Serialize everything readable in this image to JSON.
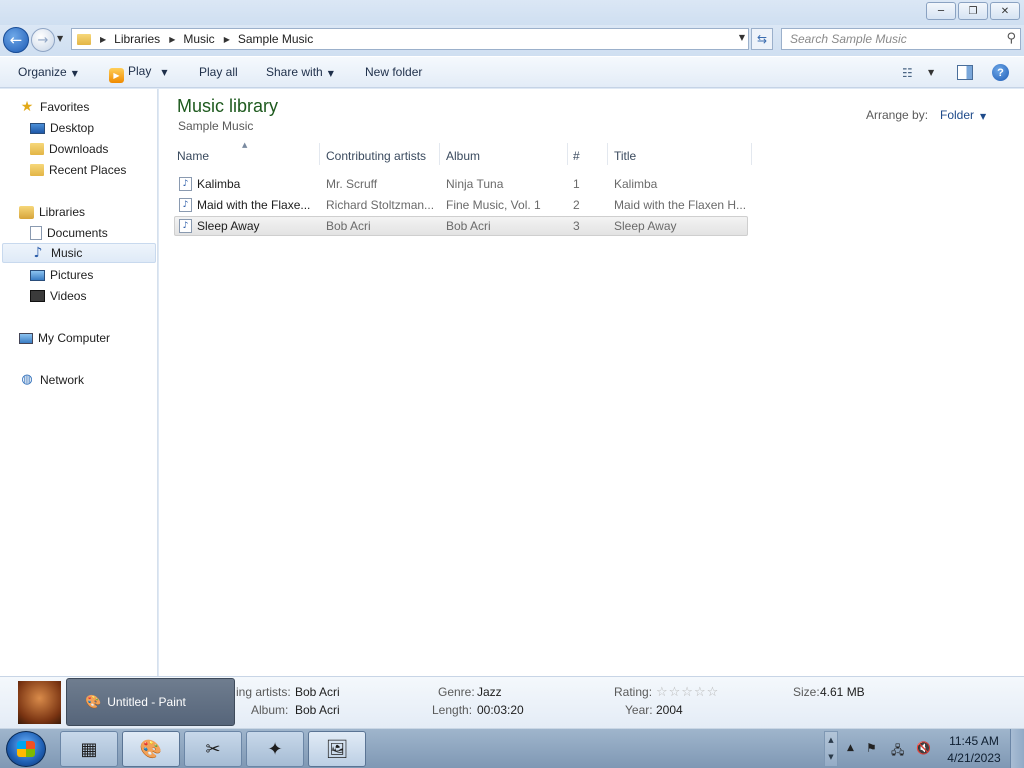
{
  "window": {
    "minimize_glyph": "─",
    "restore_glyph": "❐",
    "close_glyph": "✕"
  },
  "address": {
    "crumbs": [
      "Libraries",
      "Music",
      "Sample Music"
    ],
    "search_placeholder": "Search Sample Music"
  },
  "toolbar": {
    "organize": "Organize",
    "play": "Play",
    "play_all": "Play all",
    "share_with": "Share with",
    "new_folder": "New folder"
  },
  "sidebar": {
    "favorites": "Favorites",
    "desktop": "Desktop",
    "downloads": "Downloads",
    "recent_places": "Recent Places",
    "libraries": "Libraries",
    "documents": "Documents",
    "music": "Music",
    "pictures": "Pictures",
    "videos": "Videos",
    "my_computer": "My Computer",
    "network": "Network"
  },
  "library": {
    "title": "Music library",
    "subtitle": "Sample Music",
    "arrange_label": "Arrange by:",
    "arrange_value": "Folder"
  },
  "columns": {
    "name": "Name",
    "artists": "Contributing artists",
    "album": "Album",
    "number": "#",
    "title": "Title"
  },
  "files": [
    {
      "name": "Kalimba",
      "artist": "Mr. Scruff",
      "album": "Ninja Tuna",
      "number": "1",
      "title": "Kalimba"
    },
    {
      "name": "Maid with the Flaxe...",
      "artist": "Richard Stoltzman...",
      "album": "Fine Music, Vol. 1",
      "number": "2",
      "title": "Maid with the Flaxen H..."
    },
    {
      "name": "Sleep Away",
      "artist": "Bob Acri",
      "album": "Bob Acri",
      "number": "3",
      "title": "Sleep Away"
    }
  ],
  "details": {
    "artists_label": "ing artists:",
    "artists_value": "Bob Acri",
    "album_label": "Album:",
    "album_value": "Bob Acri",
    "genre_label": "Genre:",
    "genre_value": "Jazz",
    "length_label": "Length:",
    "length_value": "00:03:20",
    "rating_label": "Rating:",
    "rating_stars": "☆☆☆☆☆",
    "rating_value": 0,
    "year_label": "Year:",
    "year_value": "2004",
    "size_label": "Size:",
    "size_value": "4.61 MB"
  },
  "taskbar": {
    "preview_title": "Untitled - Paint",
    "time": "11:45 AM",
    "date": "4/21/2023"
  }
}
